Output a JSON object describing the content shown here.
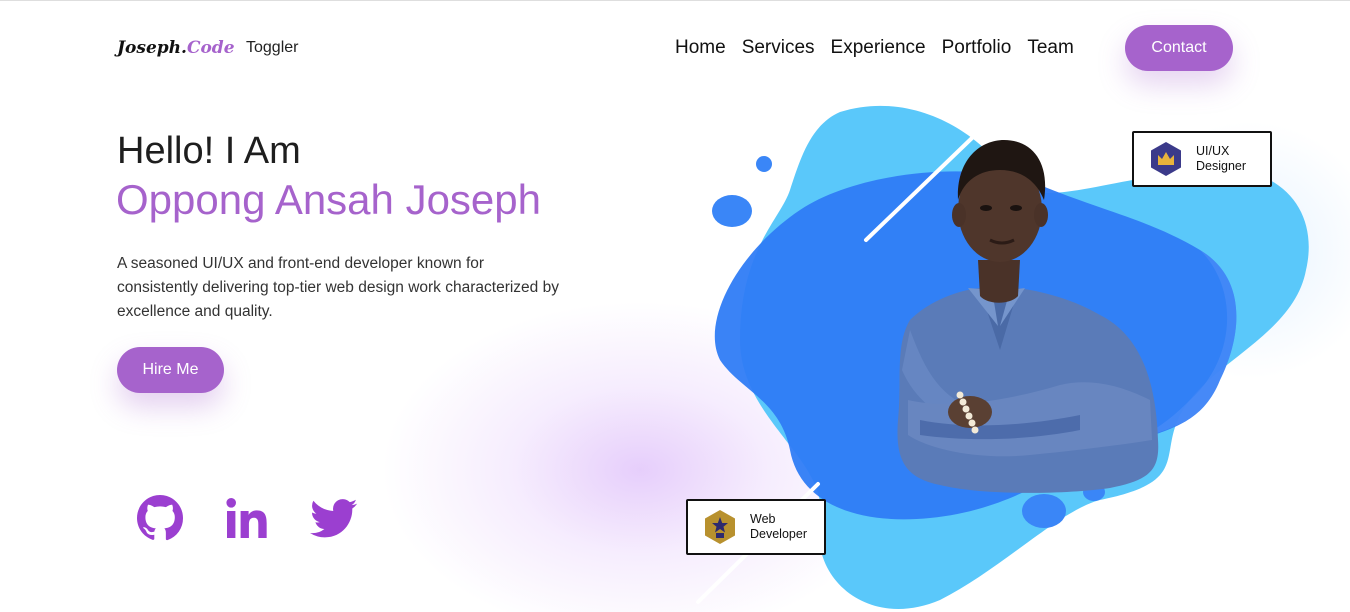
{
  "nav": {
    "brand_main": "Joseph.",
    "brand_accent": "Code",
    "toggler": "Toggler",
    "links": [
      "Home",
      "Services",
      "Experience",
      "Portfolio",
      "Team"
    ],
    "contact": "Contact"
  },
  "hero": {
    "greeting": "Hello! I Am",
    "name": "Oppong Ansah Joseph",
    "description": "A seasoned UI/UX and front-end developer known for consistently delivering top-tier web design work characterized by excellence and quality.",
    "cta": "Hire Me"
  },
  "social": [
    {
      "icon": "github-icon"
    },
    {
      "icon": "linkedin-icon"
    },
    {
      "icon": "twitter-icon"
    }
  ],
  "badges": {
    "uiux": {
      "line1": "UI/UX",
      "line2": "Designer",
      "icon": "crown-icon"
    },
    "web": {
      "line1": "Web",
      "line2": "Developer",
      "icon": "star-person-icon"
    }
  },
  "colors": {
    "accent": "#a663cc",
    "blob_light": "#5bc8fa",
    "blob_dark": "#2979ff",
    "shirt": "#5a7bb8"
  }
}
